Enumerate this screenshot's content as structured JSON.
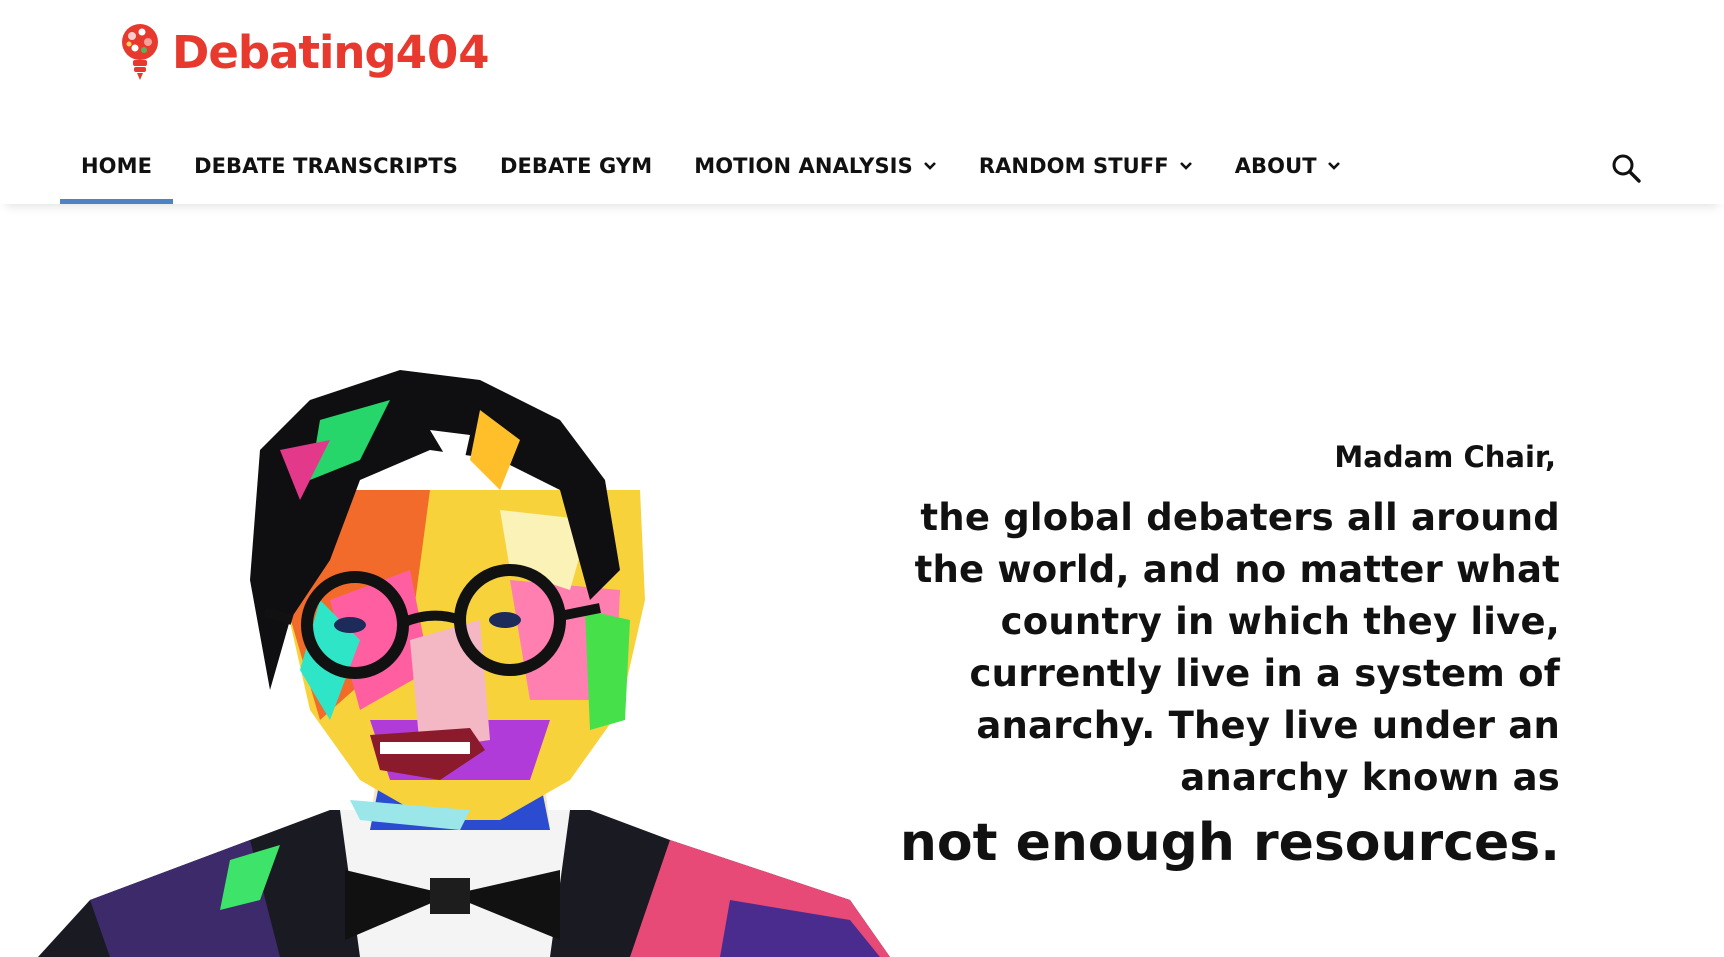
{
  "site": {
    "logo_text": "Debating",
    "logo_number": "404"
  },
  "menu": {
    "items": [
      {
        "label": "HOME",
        "active": true,
        "has_dropdown": false
      },
      {
        "label": "DEBATE TRANSCRIPTS",
        "active": false,
        "has_dropdown": false
      },
      {
        "label": "DEBATE GYM",
        "active": false,
        "has_dropdown": false
      },
      {
        "label": "MOTION ANALYSIS",
        "active": false,
        "has_dropdown": true
      },
      {
        "label": "RANDOM STUFF",
        "active": false,
        "has_dropdown": true
      },
      {
        "label": "ABOUT",
        "active": false,
        "has_dropdown": true
      }
    ],
    "search_icon": "search-icon"
  },
  "hero": {
    "salutation": "Madam Chair,",
    "lines": [
      "the global debaters all around",
      "the world, and no matter what",
      "country in which they live,",
      "currently live in a system of",
      "anarchy. They live under an",
      "anarchy known as"
    ],
    "punchline": "not enough resources."
  },
  "colors": {
    "brand": "#e8392f",
    "active_underline": "#4e82c3",
    "text": "#111111"
  }
}
